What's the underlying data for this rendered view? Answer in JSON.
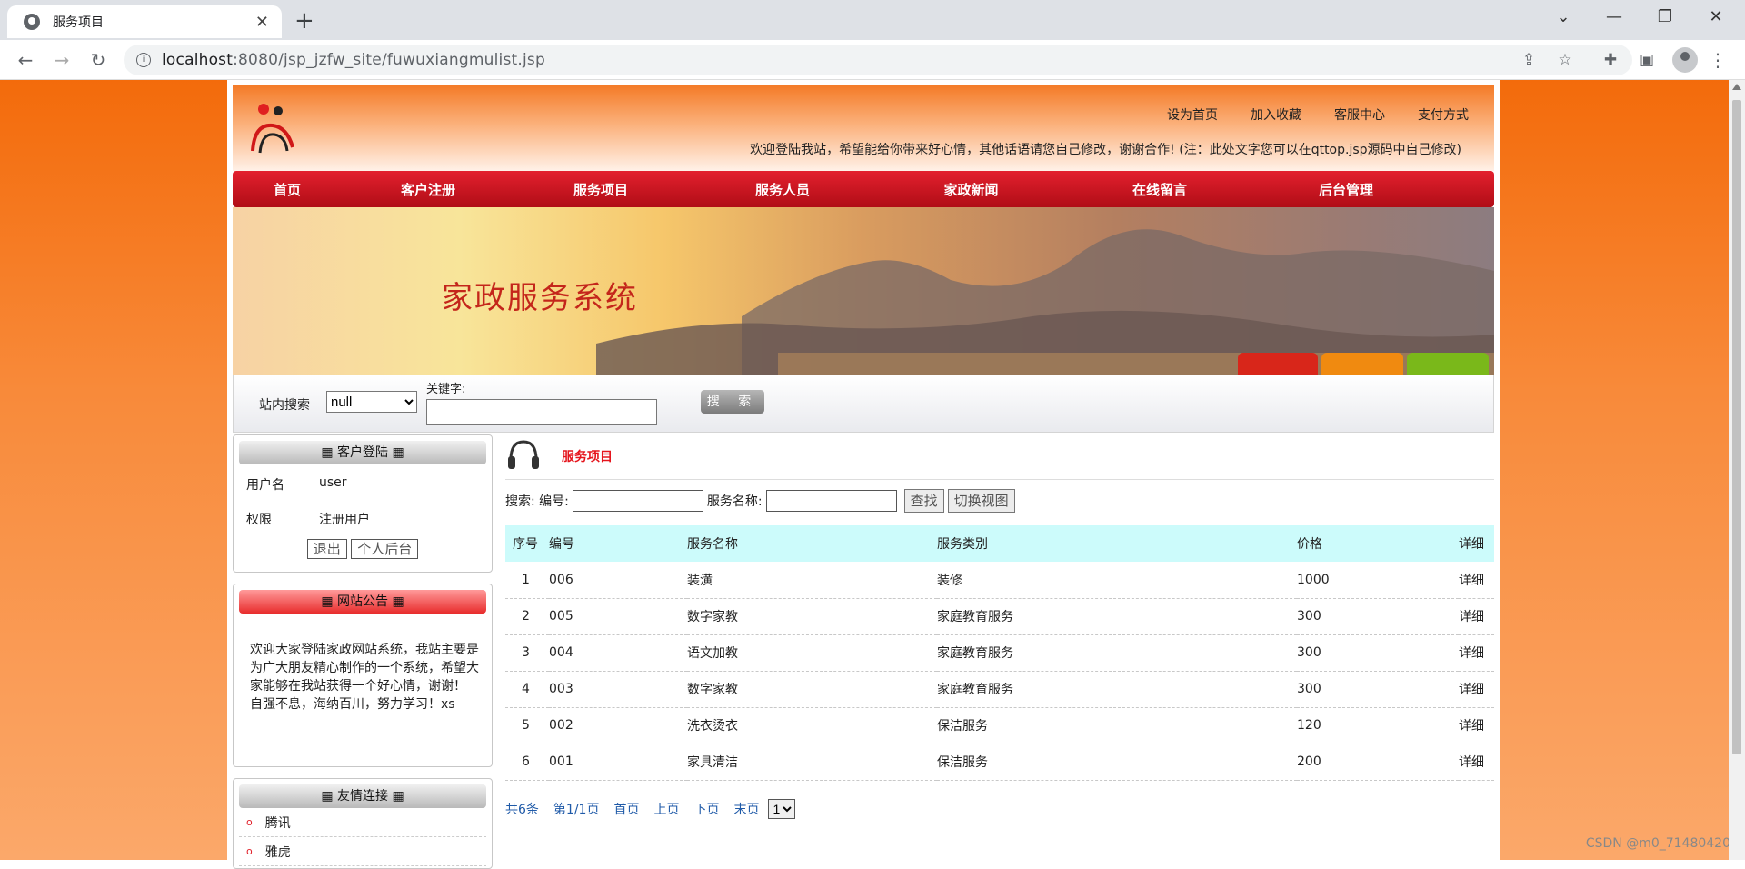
{
  "browser": {
    "tab_title": "服务项目",
    "url_host": "localhost",
    "url_rest": ":8080/jsp_jzfw_site/fuwuxiangmulist.jsp"
  },
  "header": {
    "links": [
      "设为首页",
      "加入收藏",
      "客服中心",
      "支付方式"
    ],
    "welcome": "欢迎登陆我站，希望能给你带来好心情，其他话语请您自己修改，谢谢合作!   (注：此处文字您可以在qttop.jsp源码中自己修改)"
  },
  "nav": [
    "首页",
    "客户注册",
    "服务项目",
    "服务人员",
    "家政新闻",
    "在线留言",
    "后台管理"
  ],
  "banner": {
    "title": "家政服务系统"
  },
  "site_search": {
    "label": "站内搜索",
    "select_value": "null",
    "keyword_label": "关键字:",
    "button": "搜 索"
  },
  "login_box": {
    "title": "客户登陆",
    "username_label": "用户名",
    "username": "user",
    "role_label": "权限",
    "role": "注册用户",
    "logout": "退出",
    "backend": "个人后台"
  },
  "notice_box": {
    "title": "网站公告",
    "text": "欢迎大家登陆家政网站系统，我站主要是为广大朋友精心制作的一个系统，希望大家能够在我站获得一个好心情，谢谢！ 自强不息，海纳百川，努力学习！xs"
  },
  "links_box": {
    "title": "友情连接",
    "items": [
      "腾讯",
      "雅虎"
    ]
  },
  "main": {
    "section_title": "服务项目",
    "search_prefix": "搜索: 编号:",
    "name_label": "服务名称:",
    "find_btn": "查找",
    "switch_btn": "切换视图",
    "columns": [
      "序号",
      "编号",
      "服务名称",
      "服务类别",
      "价格",
      "详细"
    ],
    "rows": [
      {
        "idx": "1",
        "code": "006",
        "name": "装潢",
        "cat": "装修",
        "price": "1000",
        "detail": "详细"
      },
      {
        "idx": "2",
        "code": "005",
        "name": "数字家教",
        "cat": "家庭教育服务",
        "price": "300",
        "detail": "详细"
      },
      {
        "idx": "3",
        "code": "004",
        "name": "语文加教",
        "cat": "家庭教育服务",
        "price": "300",
        "detail": "详细"
      },
      {
        "idx": "4",
        "code": "003",
        "name": "数字家教",
        "cat": "家庭教育服务",
        "price": "300",
        "detail": "详细"
      },
      {
        "idx": "5",
        "code": "002",
        "name": "洗衣烫衣",
        "cat": "保洁服务",
        "price": "120",
        "detail": "详细"
      },
      {
        "idx": "6",
        "code": "001",
        "name": "家具清洁",
        "cat": "保洁服务",
        "price": "200",
        "detail": "详细"
      }
    ],
    "pager": {
      "total": "共6条",
      "page": "第1/1页",
      "first": "首页",
      "prev": "上页",
      "next": "下页",
      "last": "末页",
      "select_value": "1"
    }
  },
  "watermark": "CSDN @m0_71480420",
  "colors": {
    "orange": "#f36b0b",
    "nav_red": "#d0121d",
    "title_red": "#e5141c",
    "table_head": "#ccfbfb"
  }
}
